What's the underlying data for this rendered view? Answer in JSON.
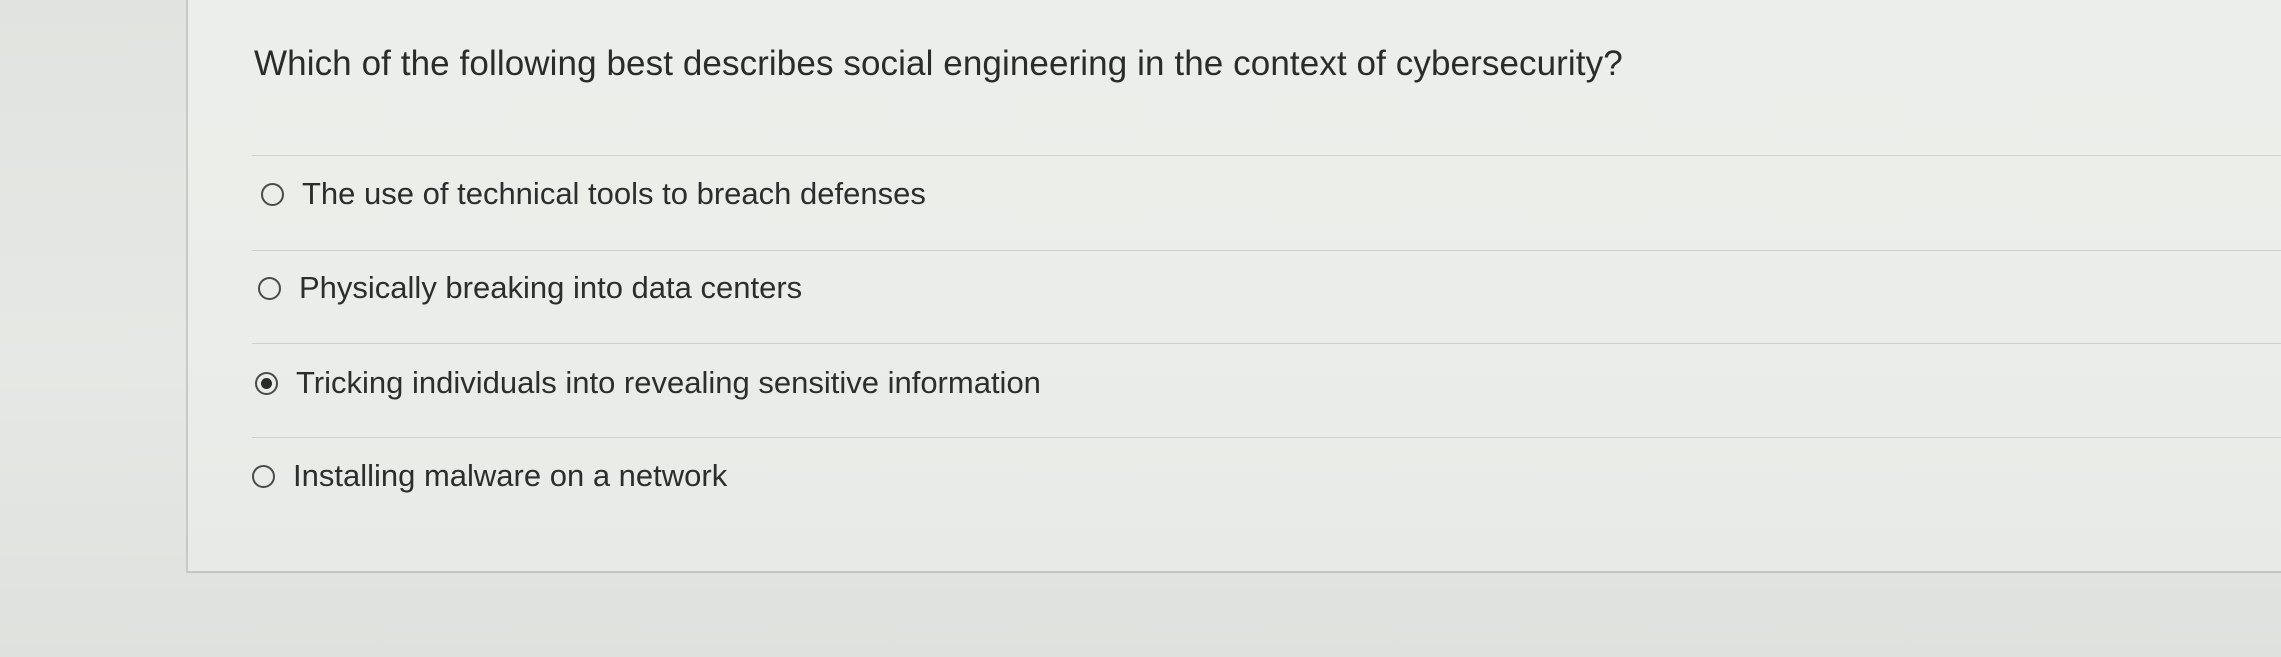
{
  "question": {
    "text": "Which of the following best describes social engineering in the context of cybersecurity?"
  },
  "options": [
    {
      "label": "The use of technical tools to breach defenses",
      "selected": false
    },
    {
      "label": "Physically breaking into data centers",
      "selected": false
    },
    {
      "label": "Tricking individuals into revealing sensitive information",
      "selected": true
    },
    {
      "label": "Installing malware on a network",
      "selected": false
    }
  ],
  "colors": {
    "background": "#e3e5e2",
    "card": "#ebedea",
    "text": "#2d2d2d",
    "radio_border": "#4a4a4a"
  }
}
